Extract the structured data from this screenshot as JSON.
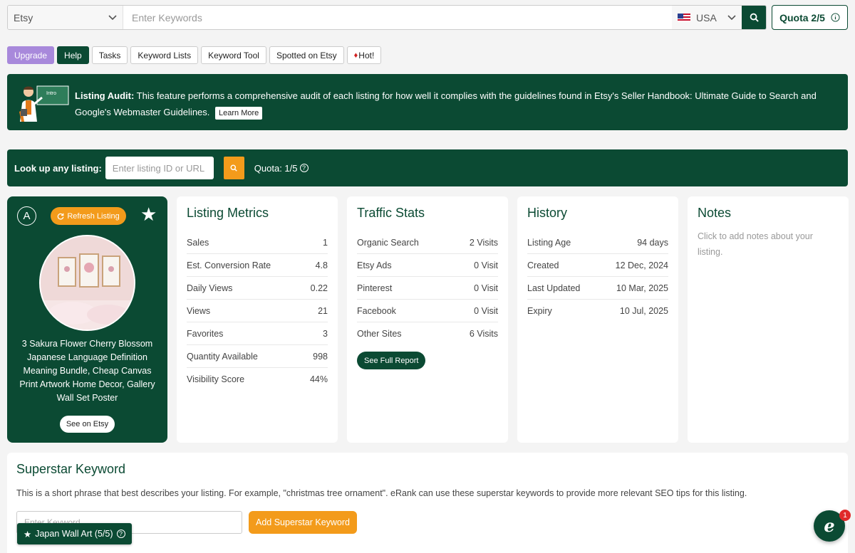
{
  "search": {
    "site": "Etsy",
    "placeholder": "Enter Keywords",
    "country": "USA",
    "quota_label": "Quota 2/5"
  },
  "nav": [
    {
      "label": "Upgrade"
    },
    {
      "label": "Help"
    },
    {
      "label": "Tasks"
    },
    {
      "label": "Keyword Lists"
    },
    {
      "label": "Keyword Tool"
    },
    {
      "label": "Spotted on Etsy"
    },
    {
      "label": "Hot!"
    }
  ],
  "banner": {
    "mascot_text": "Intro",
    "title": "Listing Audit:",
    "text": "This feature performs a comprehensive audit of each listing for how well it complies with the guidelines found in Etsy's Seller Handbook: Ultimate Guide to Search and Google's Webmaster Guidelines.",
    "learn_more": "Learn More"
  },
  "lookup": {
    "label": "Look up any listing:",
    "placeholder": "Enter listing ID or URL",
    "quota": "Quota: 1/5"
  },
  "listing": {
    "grade": "A",
    "refresh_label": "Refresh Listing",
    "title": "3 Sakura Flower Cherry Blossom Japanese Language Definition Meaning Bundle, Cheap Canvas Print Artwork Home Decor, Gallery Wall Set Poster",
    "see_on_etsy": "See on Etsy"
  },
  "metrics": {
    "title": "Listing Metrics",
    "rows": [
      {
        "label": "Sales",
        "value": "1"
      },
      {
        "label": "Est. Conversion Rate",
        "value": "4.8"
      },
      {
        "label": "Daily Views",
        "value": "0.22"
      },
      {
        "label": "Views",
        "value": "21"
      },
      {
        "label": "Favorites",
        "value": "3"
      },
      {
        "label": "Quantity Available",
        "value": "998"
      },
      {
        "label": "Visibility Score",
        "value": "44%"
      }
    ]
  },
  "traffic": {
    "title": "Traffic Stats",
    "rows": [
      {
        "label": "Organic Search",
        "value": "2 Visits"
      },
      {
        "label": "Etsy Ads",
        "value": "0 Visit"
      },
      {
        "label": "Pinterest",
        "value": "0 Visit"
      },
      {
        "label": "Facebook",
        "value": "0 Visit"
      },
      {
        "label": "Other Sites",
        "value": "6 Visits"
      }
    ],
    "report_label": "See Full Report"
  },
  "history": {
    "title": "History",
    "rows": [
      {
        "label": "Listing Age",
        "value": "94 days"
      },
      {
        "label": "Created",
        "value": "12 Dec, 2024"
      },
      {
        "label": "Last Updated",
        "value": "10 Mar, 2025"
      },
      {
        "label": "Expiry",
        "value": "10 Jul, 2025"
      }
    ]
  },
  "notes": {
    "title": "Notes",
    "hint": "Click to add notes about your listing."
  },
  "superstar": {
    "title": "Superstar Keyword",
    "description": "This is a short phrase that best describes your listing. For example, \"christmas tree ornament\". eRank can use these superstar keywords to provide more relevant SEO tips for this listing.",
    "placeholder": "Enter Keyword",
    "add_label": "Add Superstar Keyword",
    "tag_label": "Japan Wall Art (5/5)"
  },
  "chat": {
    "badge": "1"
  },
  "colors": {
    "brand_green": "#0b4a33",
    "accent_orange": "#f39b1b",
    "upgrade_purple": "#a889db"
  }
}
